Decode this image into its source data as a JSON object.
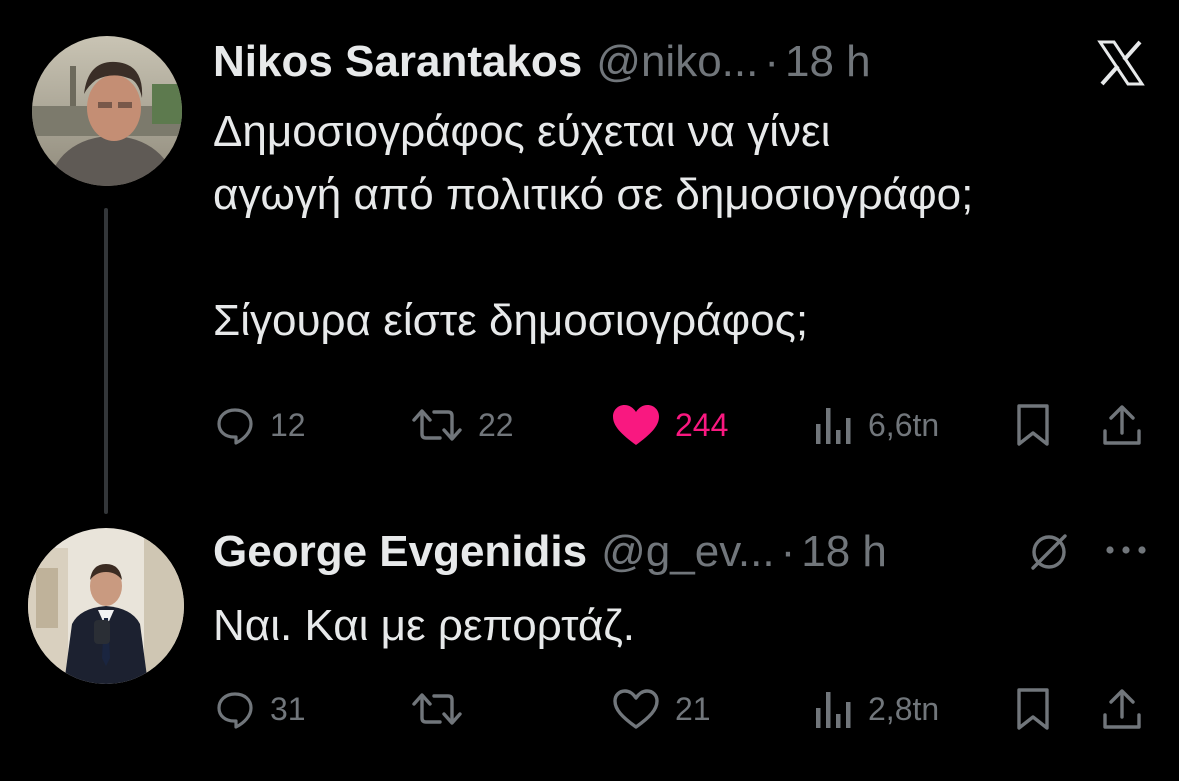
{
  "colors": {
    "background": "#000000",
    "primary_text": "#e7e9ea",
    "secondary_text": "#71767b",
    "like_active": "#f91880",
    "thread_line": "#333639"
  },
  "brand_icon": "x-logo-icon",
  "tweets": [
    {
      "display_name": "Nikos Sarantakos",
      "handle": "@niko...",
      "separator": "·",
      "time": "18 h",
      "text": "Δημοσιογράφος εύχεται να γίνει\nαγωγή από πολιτικό σε δημοσιογράφο;\n\nΣίγουρα είστε δημοσιογράφος;",
      "actions": {
        "reply_count": "12",
        "retweet_count": "22",
        "like_count": "244",
        "liked": true,
        "views_count": "6,6tn"
      }
    },
    {
      "display_name": "George Evgenidis",
      "handle": "@g_ev...",
      "separator": "·",
      "time": "18 h",
      "header_icons": [
        "slash-circle-icon",
        "more-icon"
      ],
      "text": "Ναι. Και με ρεπορτάζ.",
      "actions": {
        "reply_count": "31",
        "retweet_count": "",
        "like_count": "21",
        "liked": false,
        "views_count": "2,8tn"
      }
    }
  ]
}
